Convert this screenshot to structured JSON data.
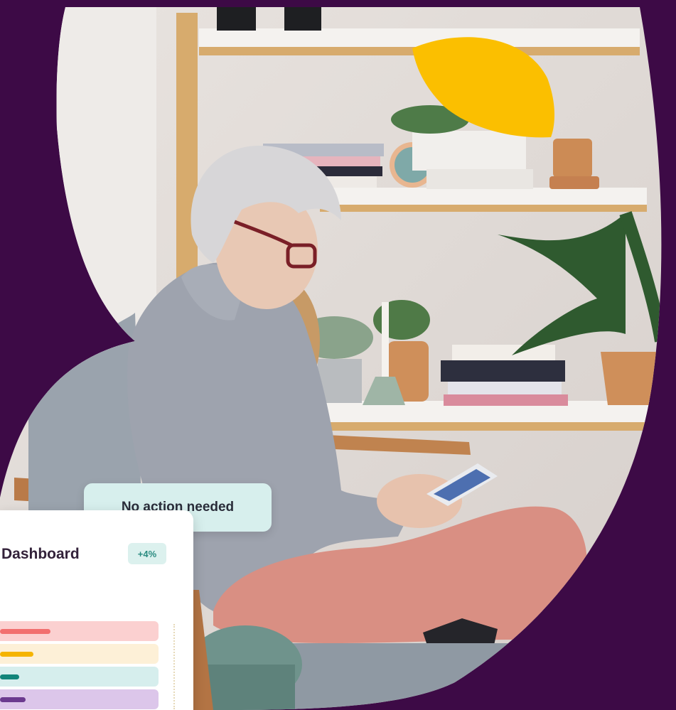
{
  "status_pill": {
    "label": "No action needed"
  },
  "dashboard_card": {
    "title": "Dashboard",
    "badge": "+4%",
    "bars": [
      {
        "track_color": "#fbd0d0",
        "fill_color": "#f26f6f",
        "level": 0.32
      },
      {
        "track_color": "#fdf0d7",
        "fill_color": "#f5b400",
        "level": 0.21
      },
      {
        "track_color": "#d6eeed",
        "fill_color": "#12857a",
        "level": 0.12
      },
      {
        "track_color": "#dcc6ea",
        "fill_color": "#6b3a8f",
        "level": 0.16
      }
    ]
  },
  "colors": {
    "background": "#3d0a46",
    "accent_yellow": "#fbbf00"
  }
}
